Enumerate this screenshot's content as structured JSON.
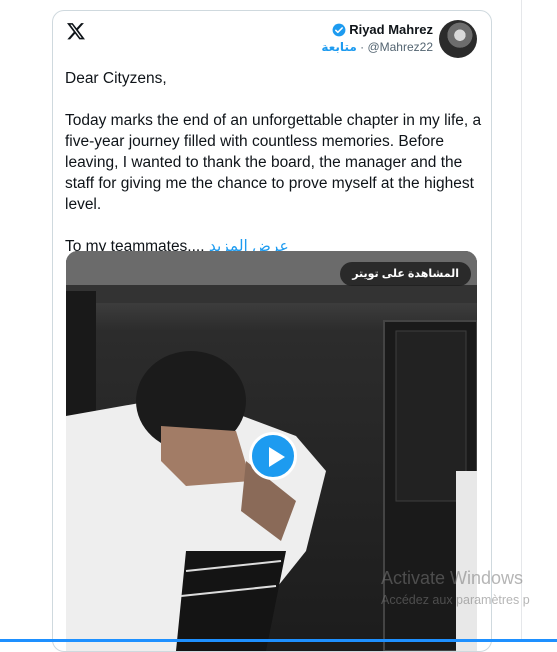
{
  "tweet": {
    "author_name": "Riyad Mahrez",
    "author_handle": "@Mahrez22",
    "follow_label": "متابعة",
    "separator": "·",
    "text_main": "Dear Cityzens,\n\nToday marks the end of an unforgettable chapter in my life, a five-year journey filled with countless memories. Before leaving, I wanted to thank the board, the manager and the staff for giving me the chance to prove myself at the highest level.\n\nTo my teammates,... ",
    "more_label": "عرض المزيد",
    "media": {
      "watch_label": "المشاهدة على تويتر"
    }
  },
  "icons": {
    "logo": "x-logo-icon",
    "verified": "verified-badge-icon",
    "play": "play-icon"
  },
  "colors": {
    "accent": "#1d9bf0",
    "text": "#0f1419",
    "muted": "#536471",
    "border": "#cfd9de"
  },
  "watermark": {
    "title": "Activate Windows",
    "subtitle": "Accédez aux paramètres p"
  }
}
